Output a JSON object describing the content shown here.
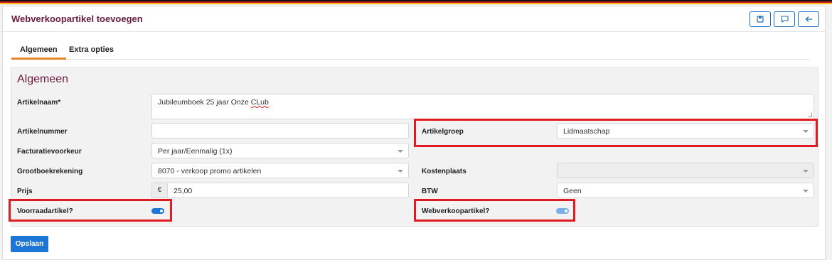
{
  "header": {
    "title": "Webverkoopartikel toevoegen"
  },
  "icons": {
    "save": "save-icon",
    "comment": "comment-icon",
    "back": "arrow-left-icon"
  },
  "tabs": [
    {
      "label": "Algemeen",
      "active": true
    },
    {
      "label": "Extra opties",
      "active": false
    }
  ],
  "panel": {
    "title": "Algemeen"
  },
  "fields": {
    "artikelnaam": {
      "label": "Artikelnaam*",
      "value_a": "Jubileumboek 25 jaar Onze ",
      "value_b": "CLub"
    },
    "artikelnummer": {
      "label": "Artikelnummer",
      "value": ""
    },
    "artikelgroep": {
      "label": "Artikelgroep",
      "value": "Lidmaatschap"
    },
    "facturatievoorkeur": {
      "label": "Facturatievoorkeur",
      "value": "Per jaar/Eenmalig (1x)"
    },
    "grootboekrekening": {
      "label": "Grootboekrekening",
      "value": "8070 - verkoop promo artikelen"
    },
    "kostenplaats": {
      "label": "Kostenplaats",
      "value": ""
    },
    "prijs": {
      "label": "Prijs",
      "currency": "€",
      "value": "25,00"
    },
    "btw": {
      "label": "BTW",
      "value": "Geen"
    },
    "voorraadartikel": {
      "label": "Voorraadartikel?",
      "checked": true
    },
    "webverkoopartikel": {
      "label": "Webverkoopartikel?",
      "checked": true
    }
  },
  "actions": {
    "save_label": "Opslaan"
  },
  "colors": {
    "accent": "#1d76d6",
    "title": "#6b1c3c",
    "highlight": "#e01b22",
    "tab_underline": "#e8852c"
  }
}
